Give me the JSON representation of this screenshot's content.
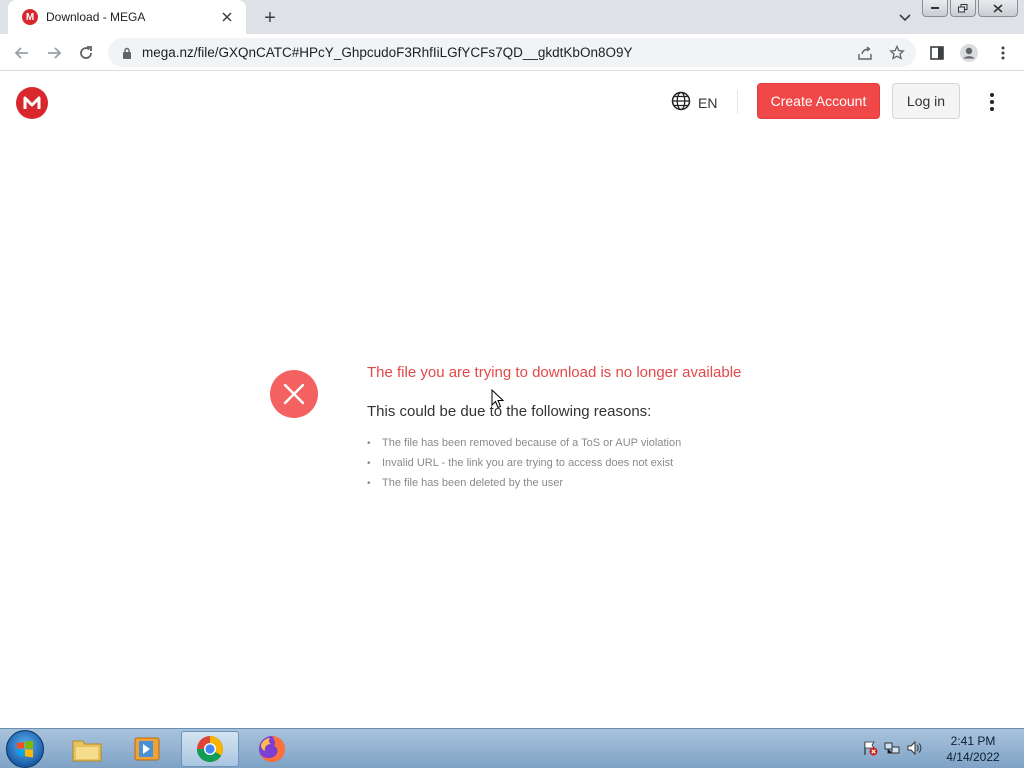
{
  "browser": {
    "tab": {
      "title": "Download - MEGA",
      "favicon": "M"
    },
    "new_tab_label": "+",
    "url": "mega.nz/file/GXQnCATC#HPcY_GhpcudoF3RhfIiLGfYCFs7QD__gkdtKbOn8O9Y"
  },
  "header": {
    "language": "EN",
    "create_account": "Create Account",
    "login": "Log in"
  },
  "error": {
    "title": "The file you are trying to download is no longer available",
    "subtitle": "This could be due to the following reasons:",
    "reasons": [
      "The file has been removed because of a ToS or AUP violation",
      "Invalid URL - the link you are trying to access does not exist",
      "The file has been deleted by the user"
    ]
  },
  "taskbar": {
    "time": "2:41 PM",
    "date": "4/14/2022",
    "apps": [
      "file-explorer-icon",
      "media-player-icon",
      "chrome-icon",
      "firefox-icon"
    ]
  },
  "colors": {
    "brand_red": "#d9272e",
    "button_red": "#f04848",
    "error_text": "#e44848",
    "error_icon": "#f46161"
  }
}
